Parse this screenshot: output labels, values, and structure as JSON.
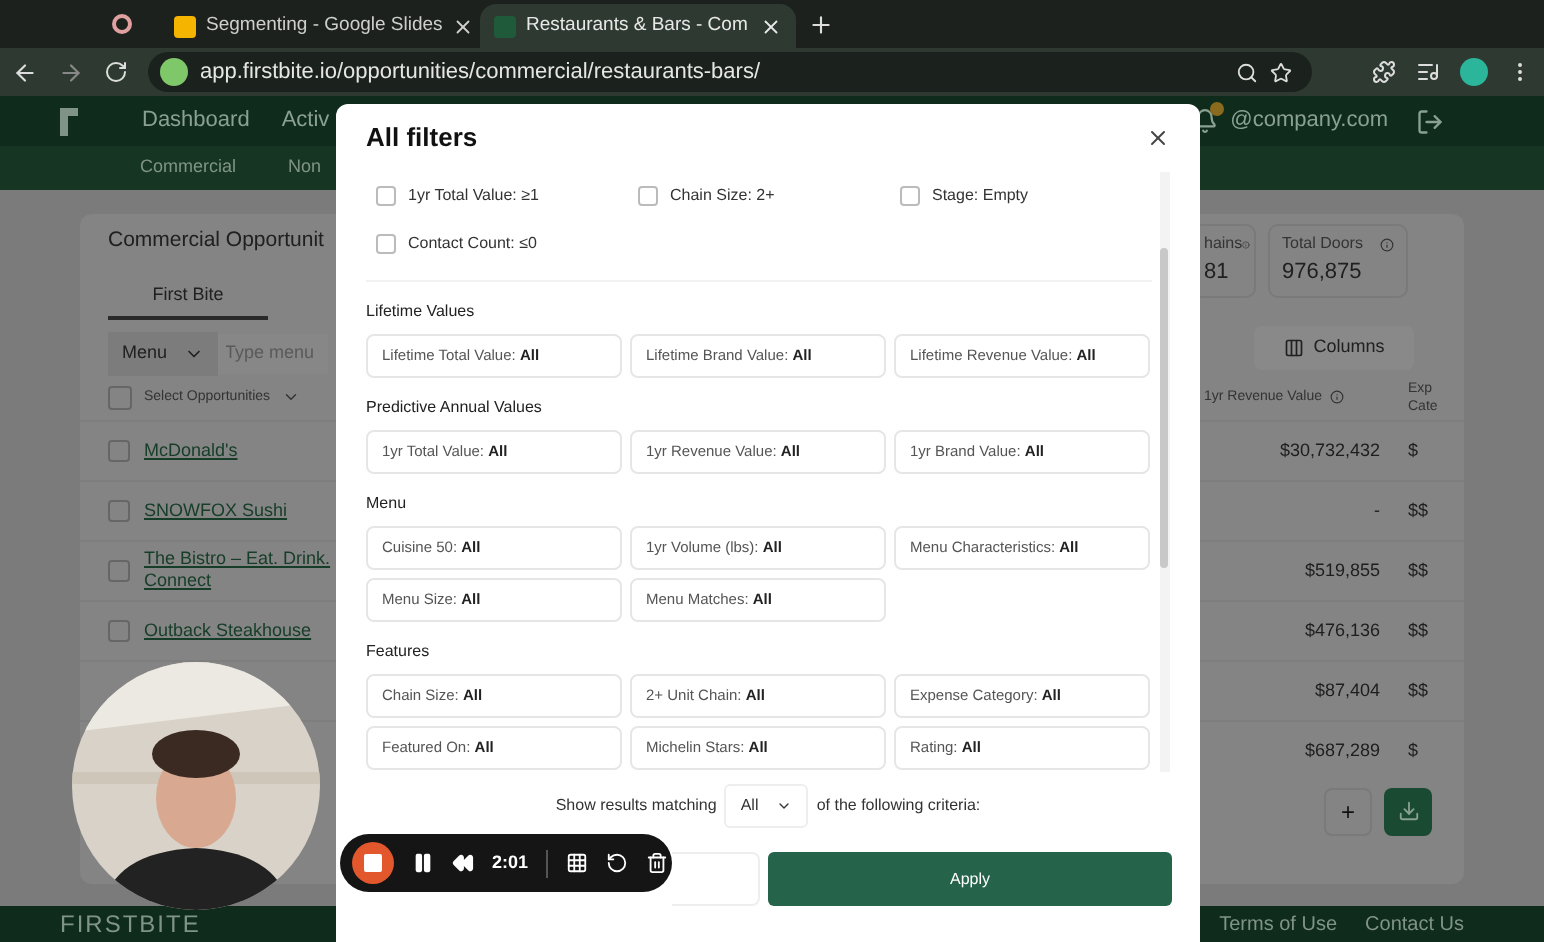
{
  "browser": {
    "tabs": [
      {
        "title": "Segmenting - Google Slides",
        "selected": false
      },
      {
        "title": "Restaurants & Bars - Com",
        "selected": true
      }
    ],
    "url": "app.firstbite.io/opportunities/commercial/restaurants-bars/"
  },
  "app_nav": {
    "items": [
      "Dashboard",
      "Activ"
    ],
    "account": "@company.com",
    "subnav": [
      "Commercial",
      "Non"
    ]
  },
  "page": {
    "title": "Commercial Opportunit",
    "tabs": [
      {
        "label": "First Bite",
        "selected": true
      }
    ],
    "menu_select": "Menu",
    "search_placeholder": "Type menu",
    "select_all_checked": false,
    "stats": [
      {
        "label": "hains",
        "value": "81"
      },
      {
        "label": "Total Doors",
        "value": "976,875"
      }
    ],
    "columns_button": "Columns",
    "table": {
      "columns": [
        "Select Opportunities",
        "1yr Revenue Value",
        "Exp Cate"
      ],
      "rows": [
        {
          "name": "McDonald's",
          "checked": false,
          "revenue": "$30,732,432",
          "category": "$"
        },
        {
          "name": "SNOWFOX Sushi",
          "checked": false,
          "revenue": "-",
          "category": "$$"
        },
        {
          "name": "The Bistro – Eat. Drink. Connect",
          "checked": false,
          "revenue": "$519,855",
          "category": "$$"
        },
        {
          "name": "Outback Steakhouse",
          "checked": false,
          "revenue": "$476,136",
          "category": "$$"
        },
        {
          "revenue": "$87,404",
          "category": "$$"
        },
        {
          "revenue": "$687,289",
          "category": "$"
        }
      ]
    },
    "add_button": "+"
  },
  "footer": {
    "brand": "FIRSTBITE",
    "links": [
      "Terms of Use",
      "Contact Us"
    ]
  },
  "modal": {
    "title": "All filters",
    "quick_filters": [
      {
        "label": "1yr Total Value: ≥1",
        "checked": false
      },
      {
        "label": "Chain Size: 2+",
        "checked": false
      },
      {
        "label": "Stage: Empty",
        "checked": false
      },
      {
        "label": "Contact Count: ≤0",
        "checked": false
      }
    ],
    "sections": [
      {
        "title": "Lifetime Values",
        "filters": [
          {
            "label": "Lifetime Total Value:",
            "value": "All"
          },
          {
            "label": "Lifetime Brand Value:",
            "value": "All"
          },
          {
            "label": "Lifetime Revenue Value:",
            "value": "All"
          }
        ]
      },
      {
        "title": "Predictive Annual Values",
        "filters": [
          {
            "label": "1yr Total Value:",
            "value": "All"
          },
          {
            "label": "1yr Revenue Value:",
            "value": "All"
          },
          {
            "label": "1yr Brand Value:",
            "value": "All"
          }
        ]
      },
      {
        "title": "Menu",
        "filters": [
          {
            "label": "Cuisine 50:",
            "value": "All"
          },
          {
            "label": "1yr Volume (lbs):",
            "value": "All"
          },
          {
            "label": "Menu Characteristics:",
            "value": "All"
          },
          {
            "label": "Menu Size:",
            "value": "All"
          },
          {
            "label": "Menu Matches:",
            "value": "All"
          }
        ]
      },
      {
        "title": "Features",
        "filters": [
          {
            "label": "Chain Size:",
            "value": "All"
          },
          {
            "label": "2+ Unit Chain:",
            "value": "All"
          },
          {
            "label": "Expense Category:",
            "value": "All"
          },
          {
            "label": "Featured On:",
            "value": "All"
          },
          {
            "label": "Michelin Stars:",
            "value": "All"
          },
          {
            "label": "Rating:",
            "value": "All"
          }
        ]
      }
    ],
    "match_prefix": "Show results matching",
    "match_value": "All",
    "match_suffix": "of the following criteria:",
    "apply_button": "Apply"
  },
  "recorder": {
    "time": "2:01"
  }
}
